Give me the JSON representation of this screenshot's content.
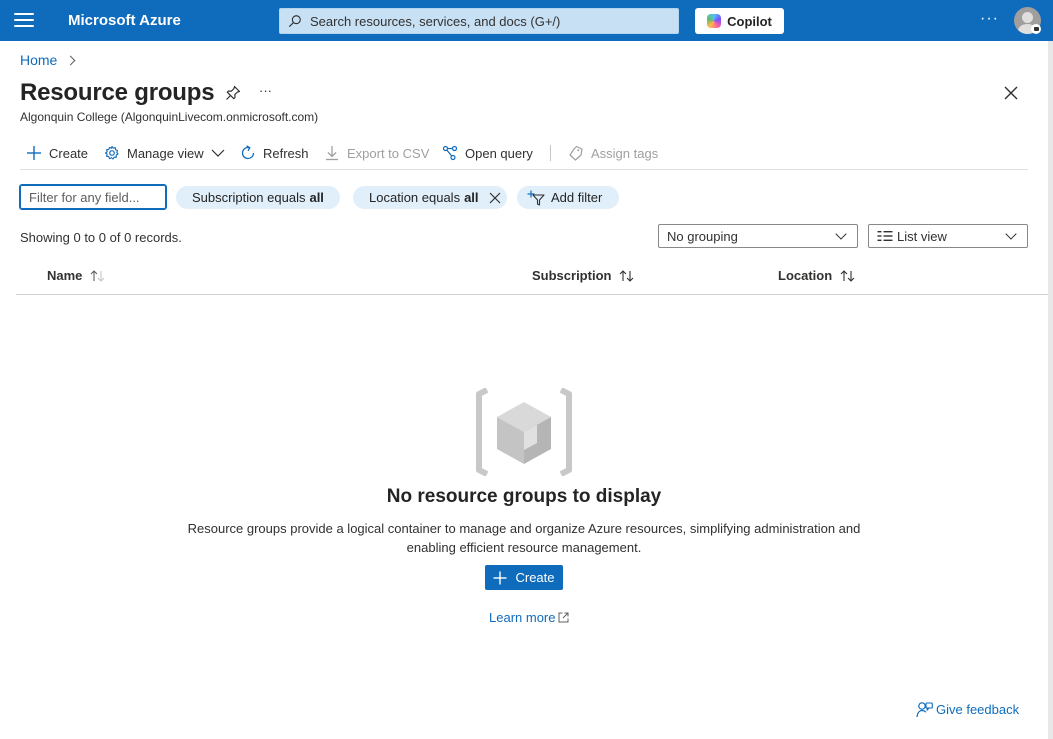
{
  "topbar": {
    "brand": "Microsoft Azure",
    "search_placeholder": "Search resources, services, and docs (G+/)",
    "copilot_label": "Copilot",
    "more_label": "···",
    "icons": [
      "menu-icon",
      "search-icon",
      "copilot-icon",
      "more-icon",
      "avatar-icon"
    ]
  },
  "breadcrumb": {
    "home": "Home"
  },
  "page": {
    "title": "Resource groups",
    "more_label": "···",
    "subtitle": "Algonquin College (AlgonquinLivecom.onmicrosoft.com)"
  },
  "toolbar": {
    "create": "Create",
    "manage_view": "Manage view",
    "refresh": "Refresh",
    "export_csv": "Export to CSV",
    "open_query": "Open query",
    "assign_tags": "Assign tags"
  },
  "filters": {
    "placeholder": "Filter for any field...",
    "subscription_label": "Subscription equals",
    "subscription_value": "all",
    "location_label": "Location equals",
    "location_value": "all",
    "add_filter": "Add filter"
  },
  "records_text": "Showing 0 to 0 of 0 records.",
  "grouping_selected": "No grouping",
  "view_selected": "List view",
  "table": {
    "columns": [
      "Name",
      "Subscription",
      "Location"
    ]
  },
  "empty_state": {
    "title": "No resource groups to display",
    "description": "Resource groups provide a logical container to manage and organize Azure resources, simplifying administration and enabling efficient resource management.",
    "create_label": "Create",
    "learn_more": "Learn more"
  },
  "feedback_label": "Give feedback",
  "colors": {
    "topbar": "#0f6cbd",
    "link": "#0f6cbd",
    "pill": "#e0effa"
  }
}
